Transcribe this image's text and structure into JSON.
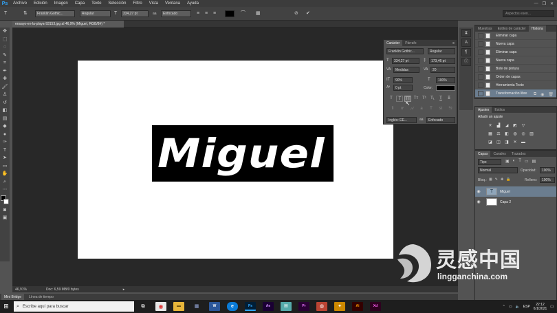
{
  "app": {
    "logo": "Ps"
  },
  "menu": [
    "Archivo",
    "Edición",
    "Imagen",
    "Capa",
    "Texto",
    "Selección",
    "Filtro",
    "Vista",
    "Ventana",
    "Ayuda"
  ],
  "window_controls": {
    "minimize": "—",
    "restore": "❐",
    "close": "✕"
  },
  "options_bar": {
    "font_family": "Franklin Gothic...",
    "font_style": "Regular",
    "font_size": "334,27 pt",
    "antialias": "Enfocado",
    "text_color": "#000000",
    "search_placeholder": "Aspectos esen..."
  },
  "document": {
    "tab_title": "ensayo-en-la-playa-93153.jpg al 46,9% (Miguel, RGB/8#) *",
    "text_layer_content": "Miguel",
    "zoom": "46,91%",
    "doc_info": "Doc: 6,59 MB/0 bytes"
  },
  "bottom_tabs": [
    "Mini Bridge",
    "Línea de tiempo"
  ],
  "character_panel": {
    "tabs": [
      "Carácter",
      "Párrafo"
    ],
    "font_family": "Franklin Gothic...",
    "font_style": "Regular",
    "font_size": "334,27 pt",
    "leading": "173,46 pt",
    "kerning": "Medidas",
    "tracking": "20",
    "vertical_scale": "90%",
    "horizontal_scale": "100%",
    "baseline_shift": "0 pt",
    "color_label": "Color:",
    "color": "#000000",
    "language": "Inglés: EE...",
    "antialias_label": "aa",
    "antialias": "Enfocado"
  },
  "history_panel": {
    "tabs": [
      "Muestras",
      "Estilos de carácter",
      "Historia"
    ],
    "items": [
      "Eliminar capa",
      "Nueva capa",
      "Eliminar capa",
      "Nueva capa",
      "Bote de pintura",
      "Orden de capas",
      "Herramienta Texto",
      "Transformación libre"
    ],
    "selected_index": 7
  },
  "adjustments_panel": {
    "tabs": [
      "Ajustes",
      "Estilos"
    ],
    "title": "Añadir un ajuste"
  },
  "layers_panel": {
    "tabs": [
      "Capas",
      "Canales",
      "Trazados"
    ],
    "filter": "Tipo",
    "blend_mode": "Normal",
    "opacity_label": "Opacidad:",
    "opacity": "100%",
    "lock_label": "Bloq.:",
    "fill_label": "Relleno:",
    "fill": "100%",
    "layers": [
      {
        "name": "Miguel",
        "thumb": "T",
        "selected": true
      },
      {
        "name": "Capa 2",
        "thumb": "",
        "selected": false
      }
    ]
  },
  "taskbar": {
    "search_placeholder": "Escribe aquí para buscar",
    "apps": [
      {
        "label": "Ps",
        "color": "#31a8ff",
        "bg": "#001e36"
      },
      {
        "label": "Ae",
        "color": "#d291ff",
        "bg": "#1a0033"
      },
      {
        "label": "Pr",
        "color": "#ea77ff",
        "bg": "#2a0035"
      },
      {
        "label": "Ai",
        "color": "#ff9a00",
        "bg": "#330000"
      },
      {
        "label": "Xd",
        "color": "#ff61f6",
        "bg": "#2e001f"
      }
    ],
    "language": "ESP",
    "time": "22:12",
    "date": "6/1/2021"
  },
  "watermark": {
    "text": "灵感中国",
    "url": "lingganchina.com"
  }
}
